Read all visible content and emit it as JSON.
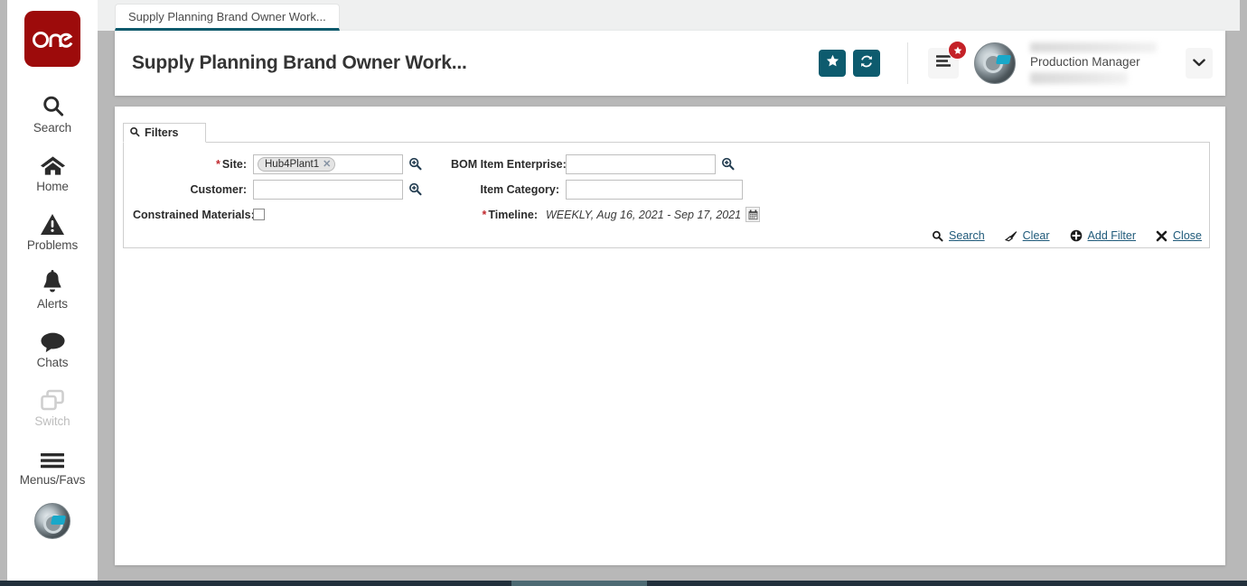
{
  "brand": {
    "logo_text": "one",
    "logo_color": "#9d0b0b"
  },
  "theme": {
    "accent": "#0d5b6e",
    "badge_red": "#c42127",
    "link": "#1f5a7a",
    "required": "#c0272d"
  },
  "sidebar": {
    "items": [
      {
        "label": "Search",
        "icon": "search-icon",
        "disabled": false
      },
      {
        "label": "Home",
        "icon": "home-icon",
        "disabled": false
      },
      {
        "label": "Problems",
        "icon": "warning-triangle-icon",
        "disabled": false
      },
      {
        "label": "Alerts",
        "icon": "bell-icon",
        "disabled": false
      },
      {
        "label": "Chats",
        "icon": "chat-bubble-icon",
        "disabled": false
      },
      {
        "label": "Switch",
        "icon": "switch-windows-icon",
        "disabled": true
      },
      {
        "label": "Menus/Favs",
        "icon": "hamburger-icon",
        "disabled": false
      }
    ],
    "avatar_icon": "user-avatar-icon"
  },
  "tabstrip": {
    "tabs": [
      {
        "label": "Supply Planning Brand Owner Work..."
      }
    ]
  },
  "header": {
    "title": "Supply Planning Brand Owner Work...",
    "favorite_icon": "star-icon",
    "refresh_icon": "refresh-icon",
    "menu_icon": "list-menu-icon",
    "menu_badge_icon": "star-badge-icon",
    "avatar_icon": "user-avatar-icon",
    "user_role": "Production Manager",
    "caret_icon": "chevron-down-icon"
  },
  "filters": {
    "tab_label": "Filters",
    "tab_icon": "search-icon",
    "fields": {
      "site": {
        "label": "Site:",
        "required": true,
        "value": "Hub4Plant1",
        "chip_remove_icon": "close-x-icon",
        "lookup_icon": "magnifier-plus-icon"
      },
      "customer": {
        "label": "Customer:",
        "required": false,
        "value": "",
        "lookup_icon": "magnifier-plus-icon"
      },
      "constrained_materials": {
        "label": "Constrained Materials:",
        "required": false,
        "checked": false
      },
      "bom_item_enterprise": {
        "label": "BOM Item Enterprise:",
        "required": false,
        "value": "",
        "lookup_icon": "magnifier-plus-icon"
      },
      "item_category": {
        "label": "Item Category:",
        "required": false,
        "value": ""
      },
      "timeline": {
        "label": "Timeline:",
        "required": true,
        "value": "WEEKLY, Aug 16, 2021 - Sep 17, 2021",
        "calendar_icon": "calendar-icon"
      }
    },
    "actions": [
      {
        "label": "Search",
        "icon": "search-icon"
      },
      {
        "label": "Clear",
        "icon": "eraser-icon"
      },
      {
        "label": "Add Filter",
        "icon": "plus-circle-icon"
      },
      {
        "label": "Close",
        "icon": "close-x-icon"
      }
    ]
  }
}
